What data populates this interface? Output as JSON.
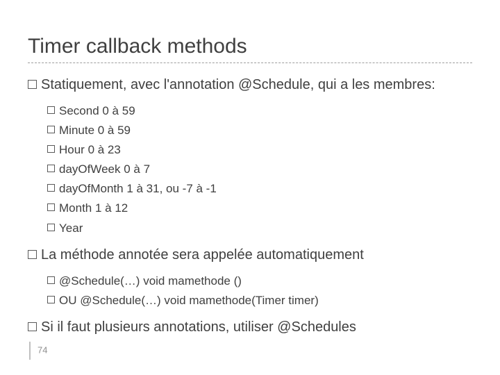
{
  "title": "Timer callback methods",
  "b1": "Statiquement, avec l'annotation @Schedule, qui a les membres:",
  "s1": "Second 0 à 59",
  "s2": "Minute 0 à 59",
  "s3": "Hour 0 à 23",
  "s4": "dayOfWeek 0 à 7",
  "s5": "dayOfMonth 1 à 31, ou -7 à -1",
  "s6": "Month 1 à 12",
  "s7": "Year",
  "b2": "La méthode annotée sera appelée automatiquement",
  "s8": "@Schedule(…) void mamethode ()",
  "s9": "OU @Schedule(…) void mamethode(Timer timer)",
  "b3": "Si il faut plusieurs annotations, utiliser @Schedules",
  "page": "74"
}
